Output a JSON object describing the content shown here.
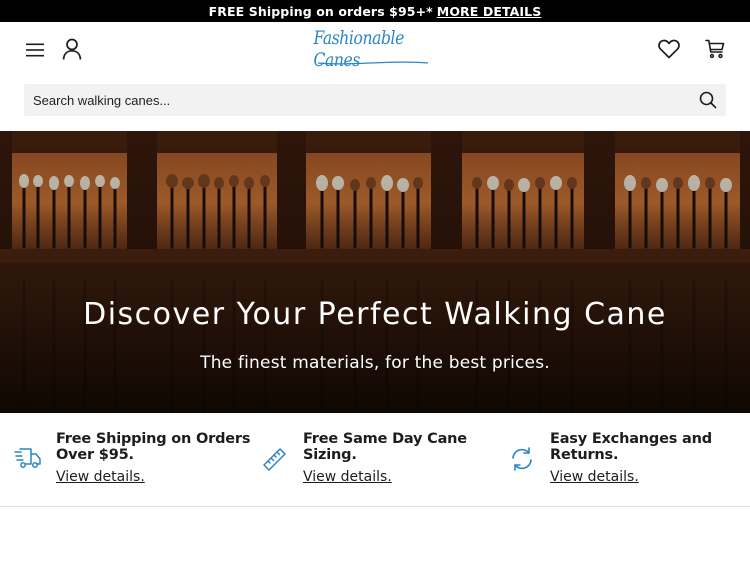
{
  "promo": {
    "text": "FREE Shipping on orders $95+*",
    "link_label": "MORE DETAILS"
  },
  "header": {
    "logo_text": "Fashionable Canes",
    "icons": {
      "menu": "hamburger-menu-icon",
      "account": "user-icon",
      "wishlist": "heart-icon",
      "cart": "shopping-cart-icon"
    }
  },
  "search": {
    "placeholder": "Search walking canes...",
    "icon": "search-icon"
  },
  "hero": {
    "title": "Discover Your Perfect Walking Cane",
    "subtitle": "The finest materials, for the best prices."
  },
  "features": [
    {
      "title": "Free Shipping on Orders Over $95.",
      "link": "View details.",
      "icon": "shipping-truck-icon"
    },
    {
      "title": "Free Same Day Cane Sizing.",
      "link": "View details.",
      "icon": "ruler-icon"
    },
    {
      "title": "Easy Exchanges and Returns.",
      "link": "View details.",
      "icon": "refresh-icon"
    }
  ],
  "colors": {
    "accent": "#2a86c6",
    "text": "#1d1d1d",
    "promo_bg": "#000000"
  }
}
